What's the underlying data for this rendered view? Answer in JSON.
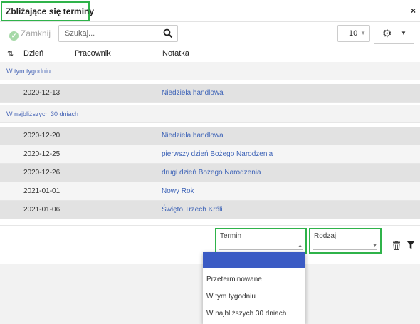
{
  "window": {
    "title": "Zbliżające się terminy",
    "close_label": "×"
  },
  "toolbar": {
    "close_button_label": "Zamknij",
    "close_button_icon": "check-circle-icon",
    "search_placeholder": "Szukaj...",
    "page_size": "10",
    "settings_icon": "gears-icon"
  },
  "table": {
    "columns": {
      "sort_icon": "⇅",
      "day": "Dzień",
      "employee": "Pracownik",
      "note": "Notatka"
    },
    "groups": [
      {
        "label": "W tym tygodniu",
        "rows": [
          {
            "date": "2020-12-13",
            "employee": "",
            "note": "Niedziela handlowa"
          }
        ]
      },
      {
        "label": "W najbliższych 30 dniach",
        "rows": [
          {
            "date": "2020-12-20",
            "employee": "",
            "note": "Niedziela handlowa"
          },
          {
            "date": "2020-12-25",
            "employee": "",
            "note": "pierwszy dzień Bożego Narodzenia"
          },
          {
            "date": "2020-12-26",
            "employee": "",
            "note": "drugi dzień Bożego Narodzenia"
          },
          {
            "date": "2021-01-01",
            "employee": "",
            "note": "Nowy Rok"
          },
          {
            "date": "2021-01-06",
            "employee": "",
            "note": "Święto Trzech Króli"
          }
        ]
      }
    ]
  },
  "filters": {
    "termin_label": "Termin",
    "rodzaj_label": "Rodzaj",
    "termin_options": [
      "",
      "Przeterminowane",
      "W tym tygodniu",
      "W najbliższych 30 dniach"
    ]
  },
  "colors": {
    "highlight": "#2fb34a",
    "link": "#3d63b7",
    "selected_option": "#3b5bc4"
  }
}
